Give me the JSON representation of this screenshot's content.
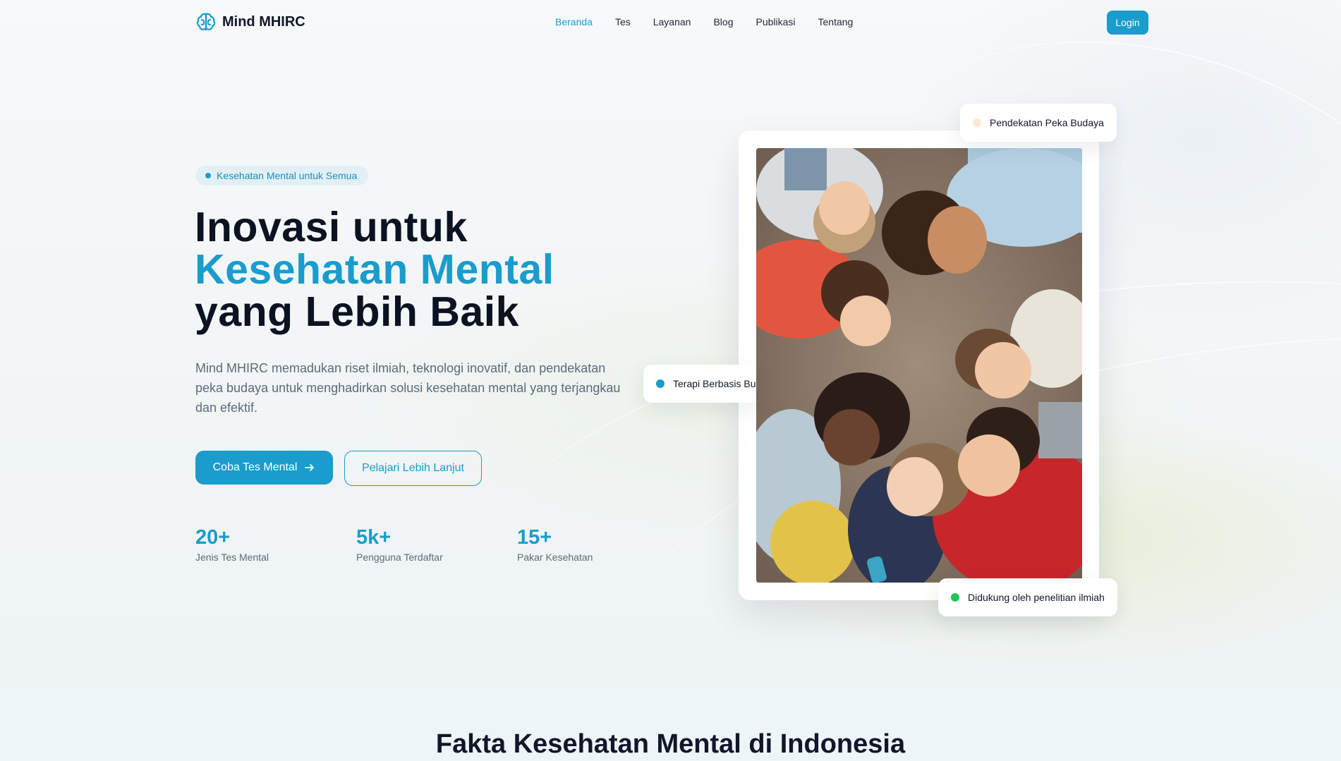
{
  "nav": {
    "brand": "Mind MHIRC",
    "links": [
      "Beranda",
      "Tes",
      "Layanan",
      "Blog",
      "Publikasi",
      "Tentang"
    ],
    "active_link": "Beranda",
    "login": "Login"
  },
  "hero": {
    "badge": "Kesehatan Mental untuk Semua",
    "headline_line1": "Inovasi untuk",
    "headline_line2": "Kesehatan Mental",
    "headline_line3": "yang Lebih Baik",
    "lead": "Mind MHIRC memadukan riset ilmiah, teknologi inovatif, dan pendekatan peka budaya untuk menghadirkan solusi kesehatan mental yang terjangkau dan efektif.",
    "cta_primary": "Coba Tes Mental",
    "cta_secondary": "Pelajari Lebih Lanjut",
    "stats": [
      {
        "value": "20+",
        "label": "Jenis Tes Mental"
      },
      {
        "value": "5k+",
        "label": "Pengguna Terdaftar"
      },
      {
        "value": "15+",
        "label": "Pakar Kesehatan"
      }
    ],
    "floating_tags": [
      {
        "text": "Pendekatan Peka Budaya",
        "dot_color": "#fde9cf"
      },
      {
        "text": "Terapi Berbasis Bu",
        "dot_color": "#1a9ccc"
      },
      {
        "text": "Didukung oleh penelitian ilmiah",
        "dot_color": "#22c55e"
      }
    ]
  },
  "facts": {
    "title": "Fakta Kesehatan Mental di Indonesia"
  },
  "colors": {
    "accent": "#1a9ccc",
    "heading": "#0b1221",
    "muted": "#5b6b7d"
  }
}
